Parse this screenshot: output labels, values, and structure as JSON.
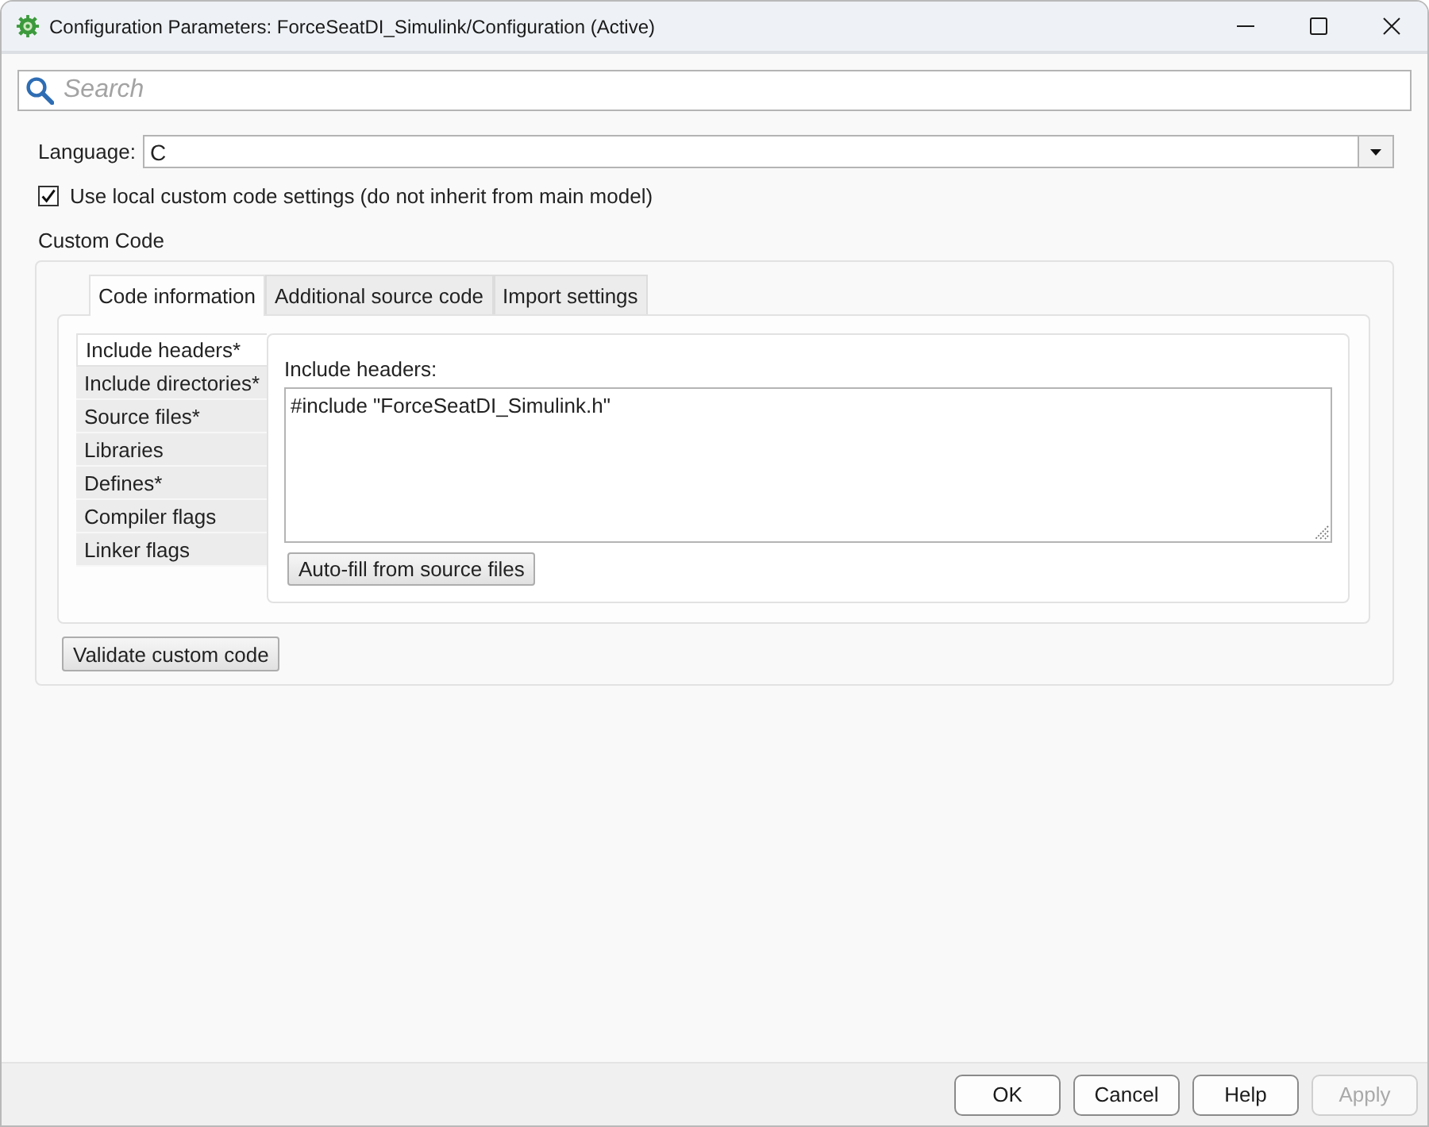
{
  "window": {
    "title": "Configuration Parameters: ForceSeatDI_Simulink/Configuration (Active)"
  },
  "search": {
    "placeholder": "Search"
  },
  "language": {
    "label": "Language:",
    "value": "C"
  },
  "use_local_settings": {
    "label": "Use local custom code settings (do not inherit from main model)",
    "checked": true
  },
  "custom_code": {
    "title": "Custom Code",
    "tabs": [
      {
        "label": "Code information",
        "selected": true
      },
      {
        "label": "Additional source code",
        "selected": false
      },
      {
        "label": "Import settings",
        "selected": false
      }
    ],
    "sections": [
      {
        "label": "Include headers*",
        "selected": true
      },
      {
        "label": "Include directories*",
        "selected": false
      },
      {
        "label": "Source files*",
        "selected": false
      },
      {
        "label": "Libraries",
        "selected": false
      },
      {
        "label": "Defines*",
        "selected": false
      },
      {
        "label": "Compiler flags",
        "selected": false
      },
      {
        "label": "Linker flags",
        "selected": false
      }
    ],
    "editor": {
      "label": "Include headers:",
      "value": "#include \"ForceSeatDI_Simulink.h\""
    },
    "autofill_button": "Auto-fill from source files",
    "validate_button": "Validate custom code"
  },
  "buttons": [
    {
      "label": "OK",
      "disabled": false
    },
    {
      "label": "Cancel",
      "disabled": false
    },
    {
      "label": "Help",
      "disabled": false
    },
    {
      "label": "Apply",
      "disabled": true
    }
  ]
}
